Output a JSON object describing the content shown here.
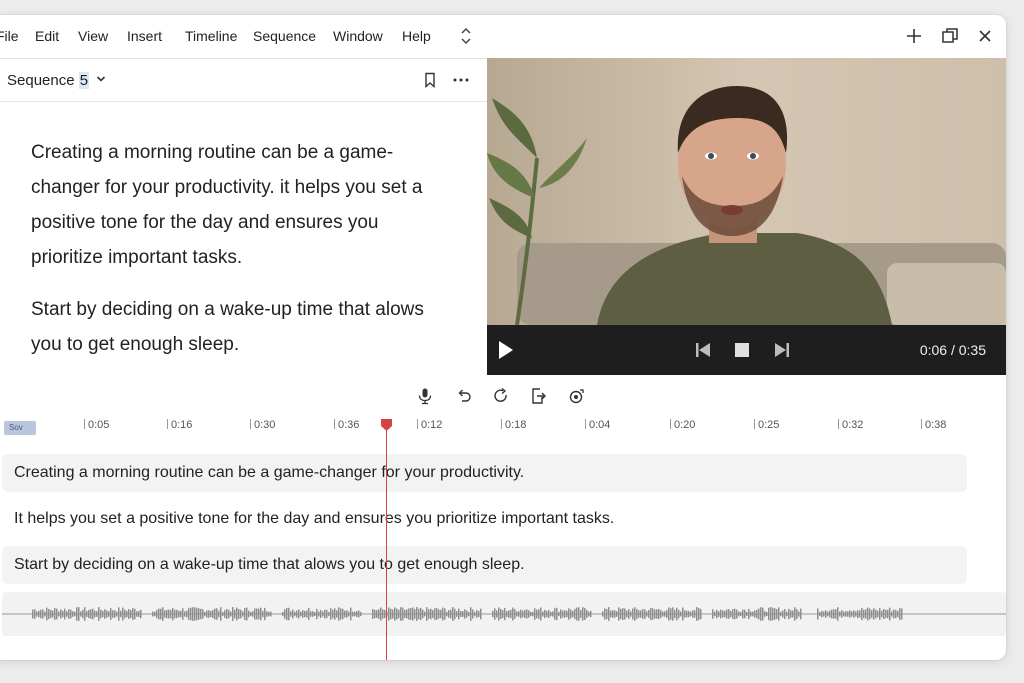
{
  "menu": {
    "items": [
      "File",
      "Edit",
      "View",
      "Insert",
      "Timeline",
      "Sequence",
      "Window",
      "Help"
    ]
  },
  "window_controls": {
    "add_icon": "plus-icon",
    "restore_icon": "restore-icon",
    "close_icon": "close-icon"
  },
  "sequence": {
    "title": "Sequence",
    "number": "5"
  },
  "script": {
    "paragraphs": [
      "Creating a morning routine can be a game-changer for your productivity. it helps you set a positive tone for the day and ensures you prioritize important tasks.",
      "Start by deciding on a wake-up time that alows you to get enough sleep."
    ]
  },
  "player": {
    "timecode": "0:06 / 0:35"
  },
  "timeline": {
    "clip_label": "Sov",
    "ticks": [
      "0:05",
      "0:16",
      "0:30",
      "0:36",
      "0:12",
      "0:18",
      "0:04",
      "0:20",
      "0:25",
      "0:32",
      "0:38"
    ],
    "left_chevron": "‹"
  },
  "transcript": {
    "rows": [
      "Creating a morning routine can be a game-changer for your productivity.",
      "It helps you set a positive tone for the day and ensures you prioritize important tasks.",
      "Start by deciding on a wake-up time that alows you to get enough sleep."
    ]
  },
  "colors": {
    "accent": "#d14545",
    "player_bar": "#1e1e1e",
    "clip": "#b9c6de"
  }
}
